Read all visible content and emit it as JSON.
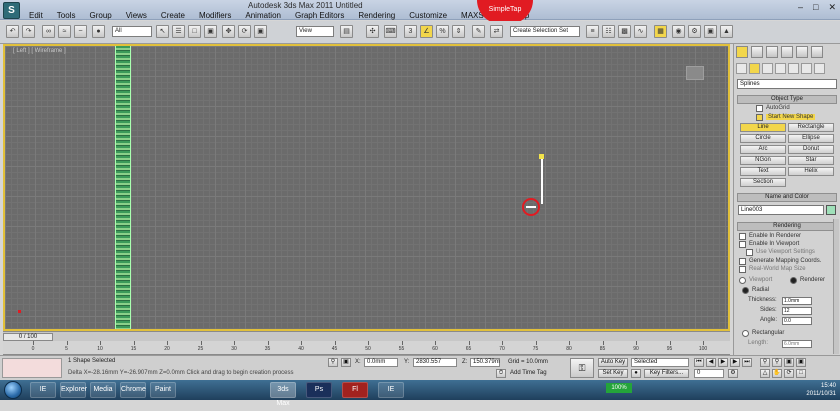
{
  "window": {
    "title": "Autodesk 3ds Max 2011    Untitled",
    "brand_badge": "SimpleTap"
  },
  "menu": [
    "Edit",
    "Tools",
    "Group",
    "Views",
    "Create",
    "Modifiers",
    "Animation",
    "Graph Editors",
    "Rendering",
    "Customize",
    "MAXScript",
    "Help"
  ],
  "toolbar": {
    "selection_filter": "All",
    "ref_coord": "View",
    "named_selection": "Create Selection Set"
  },
  "viewport": {
    "label": "[ Left ] [ Wireframe ]"
  },
  "command_panel": {
    "category": "Splines",
    "object_type_title": "Object Type",
    "autogrid": "AutoGrid",
    "start_new_shape": "Start New Shape",
    "buttons": [
      "Line",
      "Rectangle",
      "Circle",
      "Ellipse",
      "Arc",
      "Donut",
      "NGon",
      "Star",
      "Text",
      "Helix",
      "Section"
    ],
    "name_color_title": "Name and Color",
    "object_name": "Line003",
    "rendering_title": "Rendering",
    "enable_renderer": "Enable In Renderer",
    "enable_viewport": "Enable In Viewport",
    "use_viewport_settings": "Use Viewport Settings",
    "gen_mapping": "Generate Mapping Coords.",
    "real_world": "Real-World Map Size",
    "viewport_opt": "Viewport",
    "renderer_opt": "Renderer",
    "radial": "Radial",
    "thickness_label": "Thickness:",
    "thickness": "1.0mm",
    "sides_label": "Sides:",
    "sides": "12",
    "angle_label": "Angle:",
    "angle": "0.0",
    "rectangular": "Rectangular",
    "length_label": "Length:",
    "length": "6.0mm"
  },
  "timeline": {
    "frame": "0 / 100",
    "ticks": [
      "0",
      "5",
      "10",
      "15",
      "20",
      "25",
      "30",
      "35",
      "40",
      "45",
      "50",
      "55",
      "60",
      "65",
      "70",
      "75",
      "80",
      "85",
      "90",
      "95",
      "100"
    ]
  },
  "status": {
    "selected": "1 Shape Selected",
    "prompt": "Delta X=-28.16mm Y=-26.907mm Z=0.0mm  Click and drag to begin creation process",
    "x_val": "0.0mm",
    "y_val": "2830.557",
    "z_val": "150.379m",
    "grid": "Grid = 10.0mm",
    "add_time_tag": "Add Time Tag",
    "auto_key": "Auto Key",
    "set_key": "Set Key",
    "selected_dd": "Selected",
    "key_filters": "Key Filters...",
    "frame_field": "0"
  },
  "taskbar": {
    "time": "15:40",
    "date": "2011/10/31",
    "battery": "100%",
    "apps": [
      "IE",
      "Explorer",
      "Media",
      "Chrome",
      "Paint",
      "3ds Max",
      "Ps",
      "Fl",
      "IE"
    ]
  }
}
